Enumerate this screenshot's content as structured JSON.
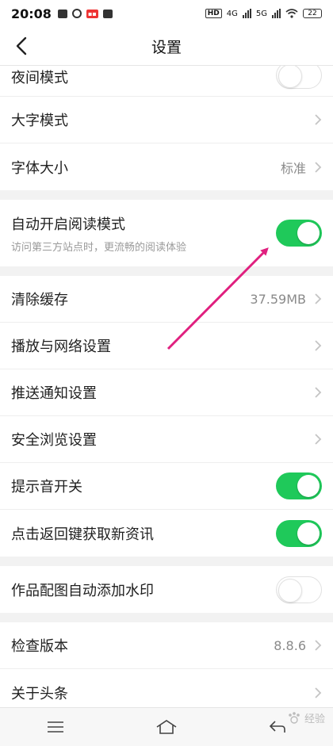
{
  "status_bar": {
    "time": "20:08",
    "net1": "HD",
    "net2": "4G",
    "net3": "5G",
    "battery": "22"
  },
  "header": {
    "title": "设置"
  },
  "groups": [
    {
      "rows": [
        {
          "label": "夜间模式",
          "control": "toggle",
          "state": "off"
        },
        {
          "label": "大字模式",
          "control": "chevron"
        },
        {
          "label": "字体大小",
          "value": "标准",
          "control": "chevron"
        }
      ]
    },
    {
      "rows": [
        {
          "label": "自动开启阅读模式",
          "sub": "访问第三方站点时，更流畅的阅读体验",
          "control": "toggle",
          "state": "on"
        }
      ]
    },
    {
      "rows": [
        {
          "label": "清除缓存",
          "value": "37.59MB",
          "control": "chevron"
        },
        {
          "label": "播放与网络设置",
          "control": "chevron"
        },
        {
          "label": "推送通知设置",
          "control": "chevron"
        },
        {
          "label": "安全浏览设置",
          "control": "chevron"
        },
        {
          "label": "提示音开关",
          "control": "toggle",
          "state": "on"
        },
        {
          "label": "点击返回键获取新资讯",
          "control": "toggle",
          "state": "on"
        }
      ]
    },
    {
      "rows": [
        {
          "label": "作品配图自动添加水印",
          "control": "toggle",
          "state": "off"
        }
      ]
    },
    {
      "rows": [
        {
          "label": "检查版本",
          "value": "8.8.6",
          "control": "chevron"
        },
        {
          "label": "关于头条",
          "control": "chevron"
        }
      ]
    }
  ],
  "watermark": "经验",
  "colors": {
    "toggle_on": "#1fc95a",
    "arrow": "#e0207f"
  },
  "icons": [
    "back-arrow-icon",
    "chevron-right-icon",
    "menu-icon",
    "home-icon",
    "back-nav-icon"
  ]
}
